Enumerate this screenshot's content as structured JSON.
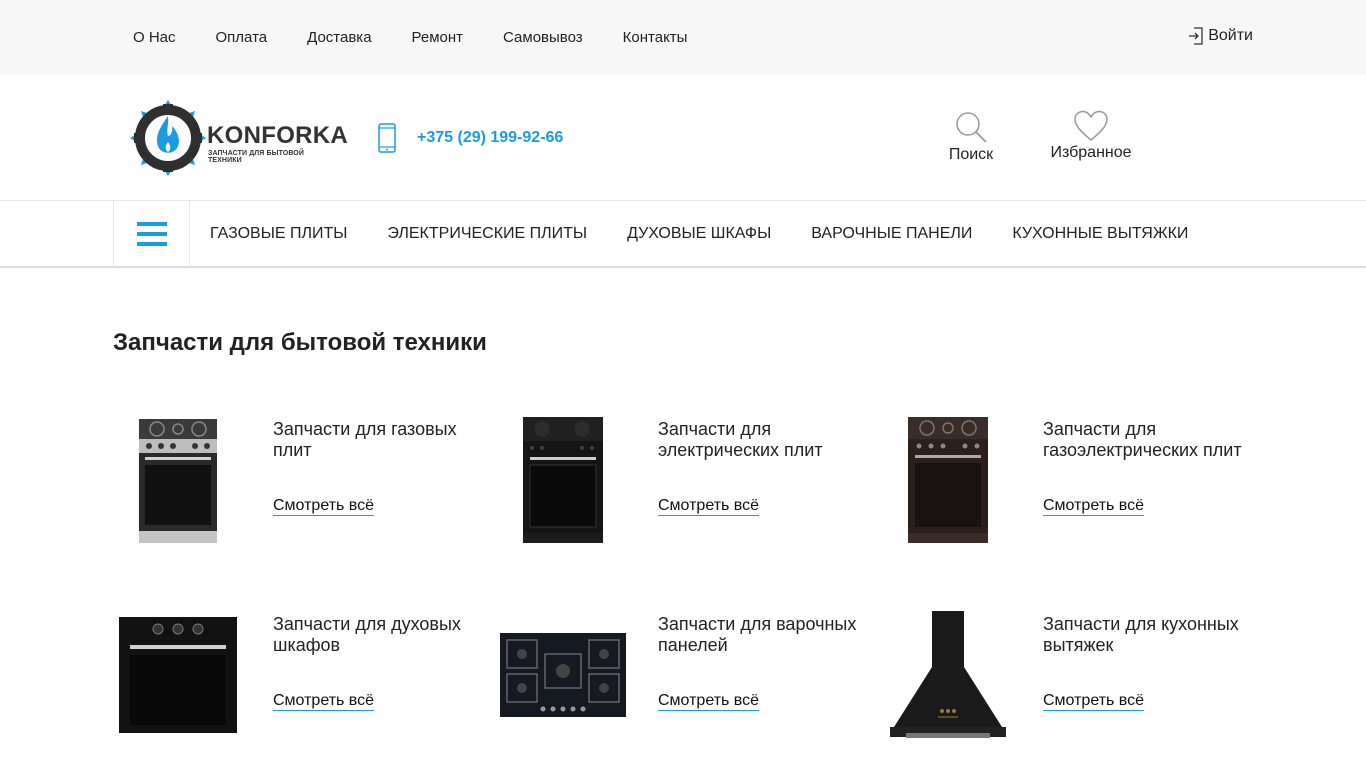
{
  "topnav": {
    "items": [
      "О Нас",
      "Оплата",
      "Доставка",
      "Ремонт",
      "Самовывоз",
      "Контакты"
    ],
    "login_label": "Войти"
  },
  "header": {
    "brand": "KONFORKA",
    "tagline": "ЗАПЧАСТИ ДЛЯ БЫТОВОЙ ТЕХНИКИ",
    "phone": "+375 (29) 199-92-66",
    "search_label": "Поиск",
    "favorites_label": "Избранное"
  },
  "catnav": {
    "items": [
      "ГАЗОВЫЕ ПЛИТЫ",
      "ЭЛЕКТРИЧЕСКИЕ ПЛИТЫ",
      "ДУХОВЫЕ ШКАФЫ",
      "ВАРОЧНЫЕ ПАНЕЛИ",
      "КУХОННЫЕ ВЫТЯЖКИ"
    ]
  },
  "main": {
    "title": "Запчасти для бытовой техники",
    "cards": [
      {
        "title": "Запчасти для газовых плит",
        "link": "Смотреть всё",
        "icon": "gas-stove-image"
      },
      {
        "title": "Запчасти для электрических плит",
        "link": "Смотреть всё",
        "icon": "electric-stove-image"
      },
      {
        "title": "Запчасти для газоэлектрических плит",
        "link": "Смотреть всё",
        "icon": "gas-electric-stove-image"
      },
      {
        "title": "Запчасти для духовых шкафов",
        "link": "Смотреть всё",
        "icon": "oven-image"
      },
      {
        "title": "Запчасти для варочных панелей",
        "link": "Смотреть всё",
        "icon": "hob-image"
      },
      {
        "title": "Запчасти для кухонных вытяжек",
        "link": "Смотреть всё",
        "icon": "hood-image"
      }
    ]
  },
  "colors": {
    "accent": "#1a9ce0",
    "topbar_bg": "#f7f7f7",
    "text": "#222222"
  }
}
